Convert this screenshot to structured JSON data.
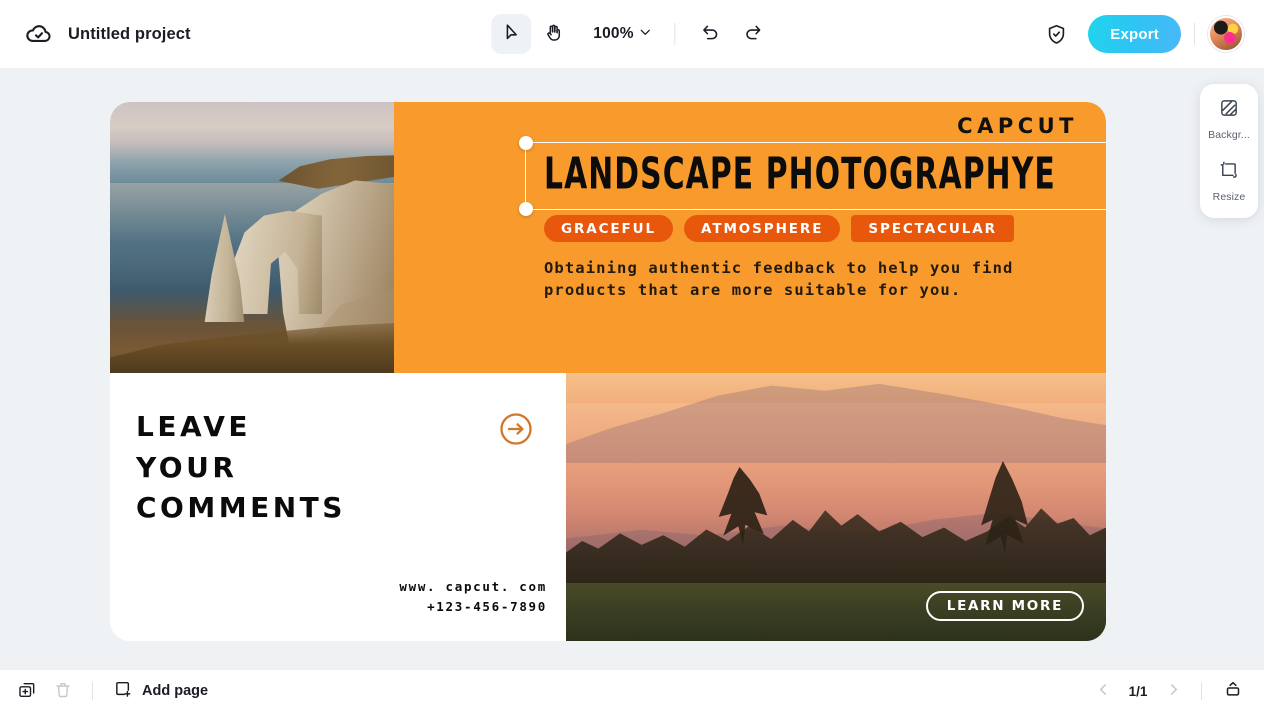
{
  "topbar": {
    "cloud_icon": "cloud-check-icon",
    "project_title": "Untitled project",
    "tools": [
      {
        "name": "select-tool",
        "icon": "cursor-arrow-icon",
        "active": true
      },
      {
        "name": "hand-tool",
        "icon": "hand-icon",
        "active": false
      }
    ],
    "zoom_value": "100%",
    "zoom_chevron": "chevron-down-icon",
    "undo_icon": "undo-icon",
    "redo_icon": "redo-icon",
    "shield_icon": "shield-check-icon",
    "export_label": "Export",
    "export_color": "#2EC4F3",
    "avatar": "user-avatar"
  },
  "side_panel": {
    "items": [
      {
        "label": "Backgr...",
        "icon": "background-hatch-icon",
        "name": "background"
      },
      {
        "label": "Resize",
        "icon": "resize-icon",
        "name": "resize"
      }
    ]
  },
  "design": {
    "background_color": "#F99B2C",
    "tag_color": "#E7580D",
    "brand": "CAPCUT",
    "title": "LANDSCAPE PHOTOGRAPHYE",
    "tags": [
      {
        "label": "GRACEFUL",
        "shape": "pill"
      },
      {
        "label": "ATMOSPHERE",
        "shape": "pill"
      },
      {
        "label": "SPECTACULAR",
        "shape": "boxy"
      }
    ],
    "description": "Obtaining authentic feedback to help you find products that are more suitable for you.",
    "comments_heading": "LEAVE\nYOUR\nCOMMENTS",
    "arrow_icon": "arrow-right-circle-icon",
    "website": "www. capcut. com",
    "phone": "+123-456-7890",
    "learn_more_label": "LEARN MORE",
    "left_photo": "coastal-cliff-photo",
    "bottom_photo": "sunset-mountain-photo"
  },
  "bottombar": {
    "duplicate_icon": "duplicate-page-icon",
    "delete_icon": "trash-icon",
    "add_page_icon": "add-page-icon",
    "add_page_label": "Add page",
    "prev_icon": "chevron-left-icon",
    "page_indicator": "1/1",
    "next_icon": "chevron-right-icon",
    "collapse_icon": "collapse-panel-icon"
  }
}
